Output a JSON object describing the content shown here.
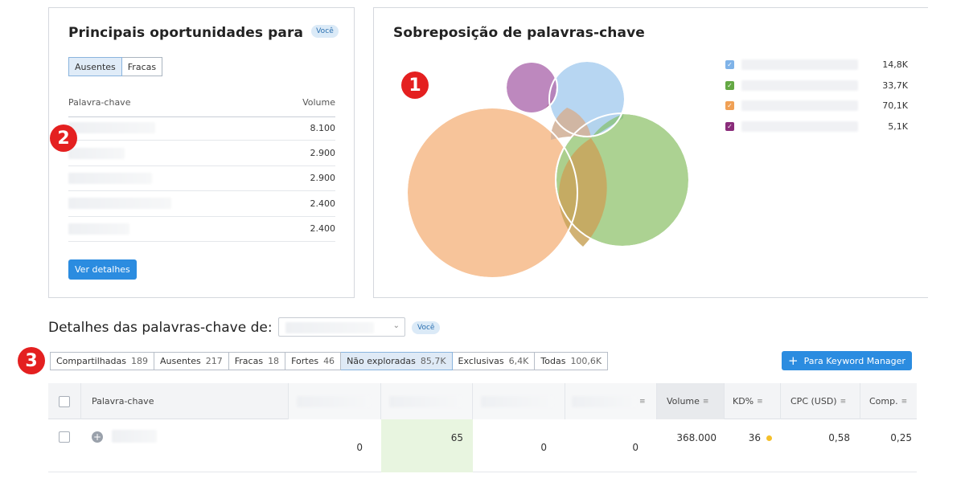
{
  "opportunities": {
    "title": "Principais oportunidades para",
    "you_badge": "Você",
    "tabs": [
      "Ausentes",
      "Fracas"
    ],
    "active_tab": "Ausentes",
    "col_keyword": "Palavra-chave",
    "col_volume": "Volume",
    "rows": [
      {
        "volume": "8.100"
      },
      {
        "volume": "2.900"
      },
      {
        "volume": "2.900"
      },
      {
        "volume": "2.400"
      },
      {
        "volume": "2.400"
      }
    ],
    "details_button": "Ver detalhes"
  },
  "overlap": {
    "title": "Sobreposição de palavras-chave",
    "legend": [
      {
        "count": "14,8K",
        "color": "#7fb3e8"
      },
      {
        "count": "33,7K",
        "color": "#64a844"
      },
      {
        "count": "70,1K",
        "color": "#f0a055"
      },
      {
        "count": "5,1K",
        "color": "#8a2c7a"
      }
    ]
  },
  "markers": [
    "1",
    "2",
    "3"
  ],
  "details": {
    "title": "Detalhes das palavras-chave de:",
    "you_badge": "Você",
    "filters": [
      {
        "label": "Compartilhadas",
        "count": "189"
      },
      {
        "label": "Ausentes",
        "count": "217"
      },
      {
        "label": "Fracas",
        "count": "18"
      },
      {
        "label": "Fortes",
        "count": "46"
      },
      {
        "label": "Não exploradas",
        "count": "85,7K"
      },
      {
        "label": "Exclusivas",
        "count": "6,4K"
      },
      {
        "label": "Todas",
        "count": "100,6K"
      }
    ],
    "active_filter": "Não exploradas",
    "keyword_manager_button": "Para Keyword Manager",
    "columns": {
      "keyword": "Palavra-chave",
      "volume": "Volume",
      "kd": "KD%",
      "cpc": "CPC (USD)",
      "comp": "Comp."
    },
    "row": {
      "pos1": "0",
      "pos2": "65",
      "pos3": "0",
      "pos4": "0",
      "volume": "368.000",
      "kd": "36",
      "cpc": "0,58",
      "comp": "0,25"
    }
  }
}
